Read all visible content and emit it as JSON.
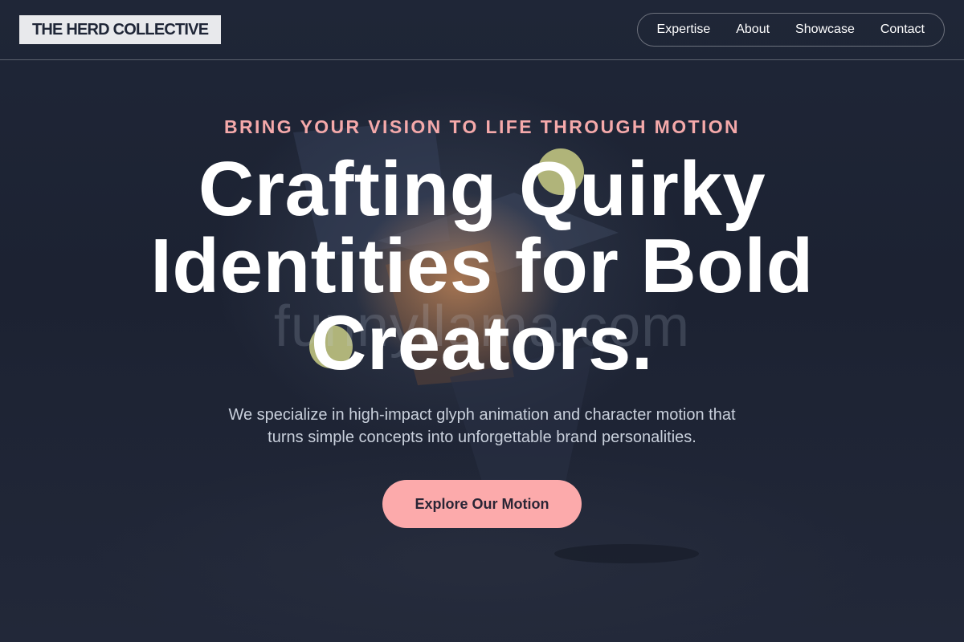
{
  "brand": {
    "logo_text": "THE HERD COLLECTIVE"
  },
  "nav": {
    "items": [
      {
        "label": "Expertise"
      },
      {
        "label": "About"
      },
      {
        "label": "Showcase"
      },
      {
        "label": "Contact"
      }
    ]
  },
  "hero": {
    "eyebrow": "BRING YOUR VISION TO LIFE THROUGH MOTION",
    "title_line1": "Crafting Quirky",
    "title_line2": "Identities for Bold",
    "title_line3": "Creators.",
    "subtitle_line1": "We specialize in high-impact glyph animation and character motion that",
    "subtitle_line2": "turns simple concepts into unforgettable brand personalities.",
    "cta_label": "Explore Our Motion"
  },
  "background": {
    "watermark_text": "funnyllama.com"
  },
  "colors": {
    "background": "#1e2535",
    "accent": "#fcaaab",
    "eyebrow": "#f5a9aa",
    "logo_bg": "#e8e9ec"
  }
}
